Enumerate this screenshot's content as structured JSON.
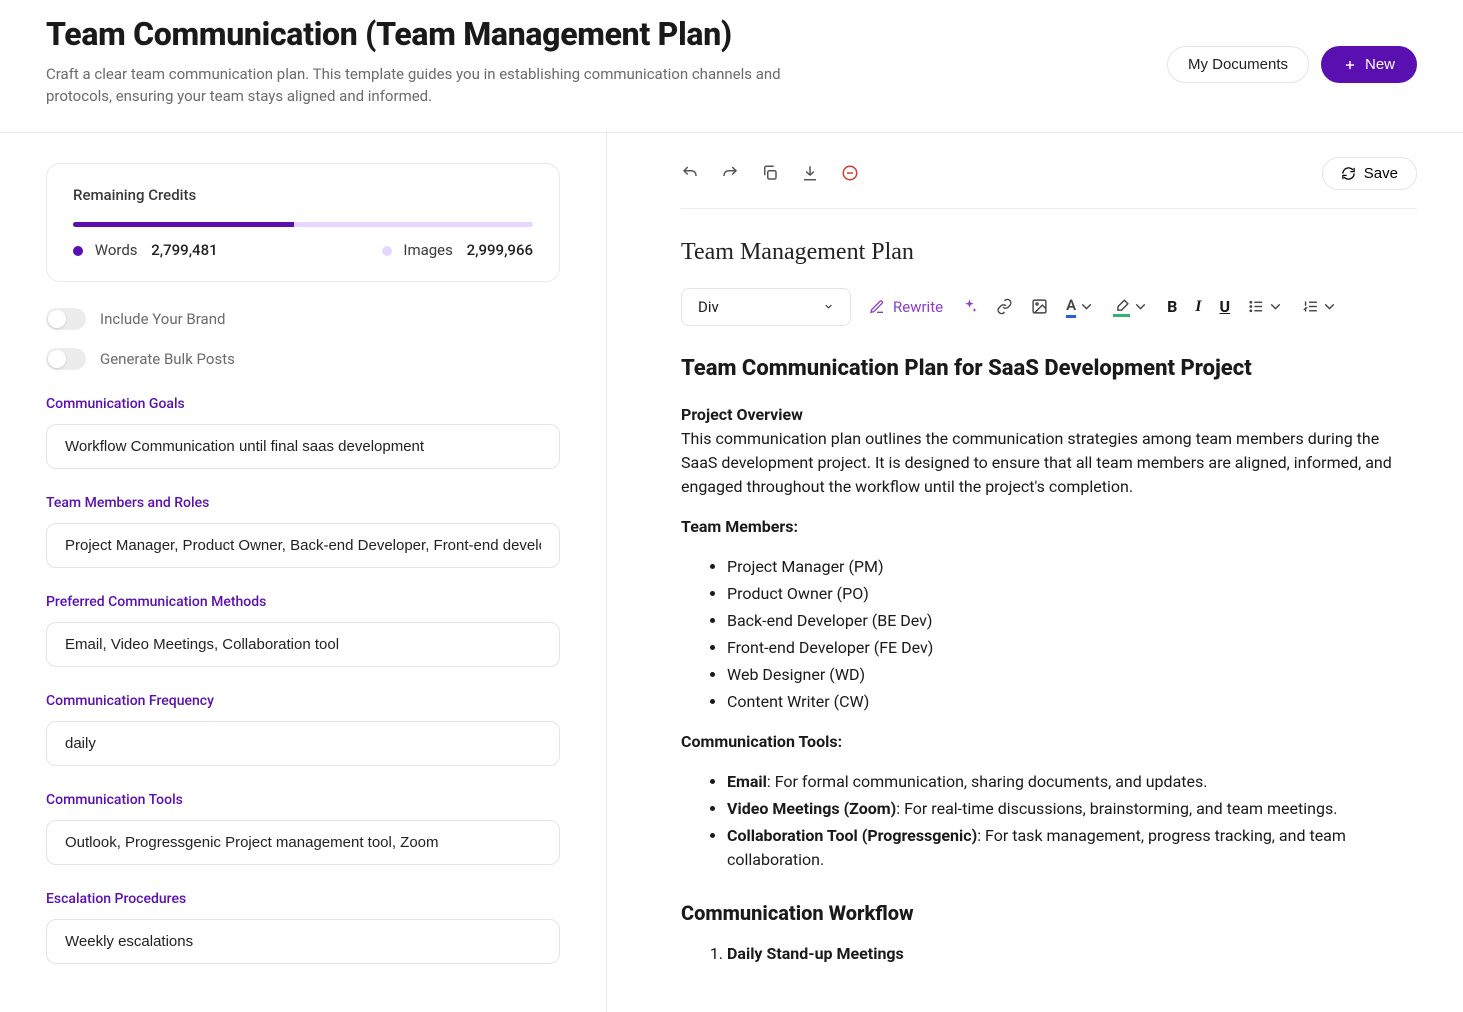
{
  "header": {
    "title": "Team Communication (Team Management Plan)",
    "description": "Craft a clear team communication plan. This template guides you in establishing communication channels and protocols, ensuring your team stays aligned and informed.",
    "myDocuments": "My Documents",
    "newBtn": "New"
  },
  "credits": {
    "title": "Remaining Credits",
    "wordsLabel": "Words",
    "wordsValue": "2,799,481",
    "imagesLabel": "Images",
    "imagesValue": "2,999,966",
    "progressPercent": 48
  },
  "toggles": {
    "brand": "Include Your Brand",
    "bulk": "Generate Bulk Posts"
  },
  "formLabels": {
    "goals": "Communication Goals",
    "members": "Team Members and Roles",
    "methods": "Preferred Communication Methods",
    "frequency": "Communication Frequency",
    "tools": "Communication Tools",
    "escalation": "Escalation Procedures"
  },
  "formValues": {
    "goals": "Workflow Communication until final saas development",
    "members": "Project Manager, Product Owner, Back-end Developer, Front-end developer",
    "methods": "Email, Video Meetings, Collaboration tool",
    "frequency": "daily",
    "tools": "Outlook, Progressgenic Project management tool, Zoom",
    "escalation": "Weekly escalations"
  },
  "editor": {
    "save": "Save",
    "docHeading": "Team Management Plan",
    "blockType": "Div",
    "rewrite": "Rewrite"
  },
  "document": {
    "mainTitle": "Team Communication Plan for SaaS Development Project",
    "overviewLabel": "Project Overview",
    "overviewText": "This communication plan outlines the communication strategies among team members during the SaaS development project. It is designed to ensure that all team members are aligned, informed, and engaged throughout the workflow until the project's completion.",
    "teamMembersLabel": "Team Members:",
    "teamMembers": [
      "Project Manager (PM)",
      "Product Owner (PO)",
      "Back-end Developer (BE Dev)",
      "Front-end Developer (FE Dev)",
      "Web Designer (WD)",
      "Content Writer (CW)"
    ],
    "toolsLabel": "Communication Tools:",
    "tools": [
      {
        "bold": "Email",
        "rest": ": For formal communication, sharing documents, and updates."
      },
      {
        "bold": "Video Meetings (Zoom)",
        "rest": ": For real-time discussions, brainstorming, and team meetings."
      },
      {
        "bold": "Collaboration Tool (Progressgenic)",
        "rest": ": For task management, progress tracking, and team collaboration."
      }
    ],
    "workflowTitle": "Communication Workflow",
    "workflowItem1": "Daily Stand-up Meetings"
  }
}
